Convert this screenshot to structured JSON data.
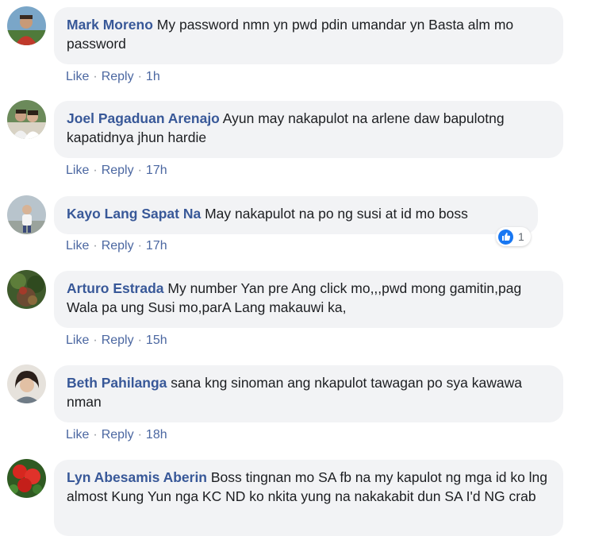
{
  "actions": {
    "like_label": "Like",
    "reply_label": "Reply",
    "separator": "·"
  },
  "comments": [
    {
      "author": "Mark Moreno",
      "text": "My password nmn yn pwd pdin umandar yn Basta alm mo password",
      "time": "1h",
      "avatar_icon": "profile-photo-man-outdoors"
    },
    {
      "author": "Joel Pagaduan Arenajo",
      "text": "Ayun may nakapulot na arlene daw bapulotng kapatidnya jhun hardie",
      "time": "17h",
      "avatar_icon": "profile-photo-couple"
    },
    {
      "author": "Kayo Lang Sapat Na",
      "text": "May nakapulot na po ng susi at id mo boss",
      "time": "17h",
      "avatar_icon": "profile-photo-child",
      "reaction_icon": "like-reaction-icon",
      "reaction_count": "1"
    },
    {
      "author": "Arturo Estrada",
      "text": "My number Yan pre Ang click mo,,,pwd mong gamitin,pag Wala pa ung Susi mo,parA Lang makauwi ka,",
      "time": "15h",
      "avatar_icon": "profile-photo-plants"
    },
    {
      "author": "Beth Pahilanga",
      "text": "sana kng sinoman ang nkapulot tawagan po sya kawawa nman",
      "time": "18h",
      "avatar_icon": "profile-photo-woman-short-hair"
    },
    {
      "author": "Lyn Abesamis Aberin",
      "text": "Boss tingnan mo SA fb na my kapulot ng mga id ko lng almost Kung Yun nga KC ND ko nkita yung na nakakabit dun SA I'd NG crab",
      "time": "",
      "avatar_icon": "profile-photo-red-flowers"
    }
  ],
  "colors": {
    "bubble_bg": "#f2f3f5",
    "author_link": "#385898",
    "action_link": "#4b67a1",
    "like_blue": "#1877f2"
  }
}
